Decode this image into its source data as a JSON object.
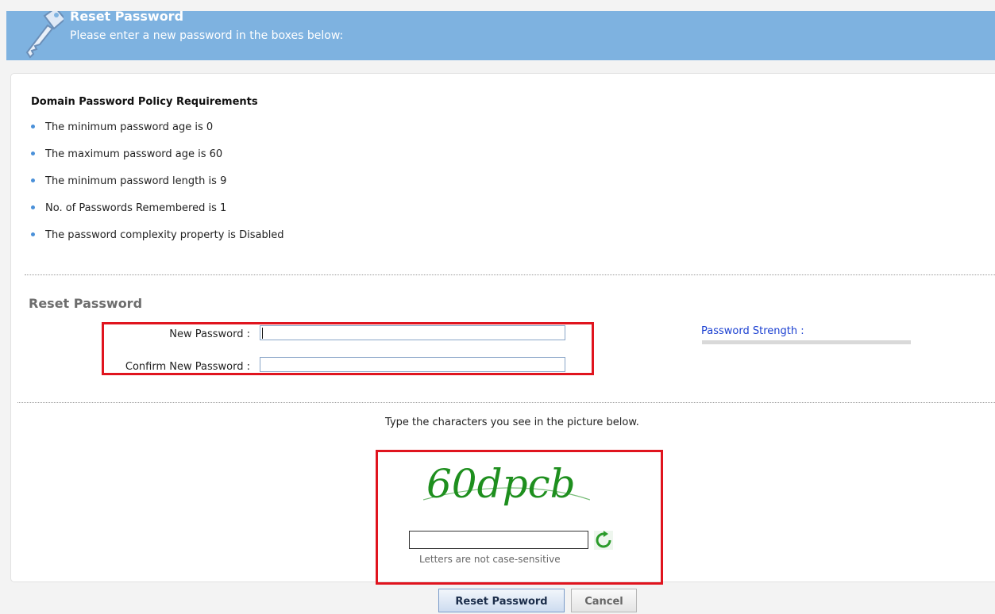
{
  "header": {
    "title": "Reset Password",
    "subtitle": "Please enter a new password in the boxes below:",
    "icon": "key-icon"
  },
  "policy": {
    "title": "Domain Password Policy Requirements",
    "items": [
      "The minimum password age is 0",
      "The maximum password age is 60",
      "The minimum password length is 9",
      "No. of Passwords Remembered is 1",
      "The password complexity property is Disabled"
    ]
  },
  "reset": {
    "section_title": "Reset Password",
    "new_password_label": "New Password :",
    "confirm_password_label": "Confirm New Password :",
    "new_password_value": "",
    "confirm_password_value": "",
    "strength_label": "Password Strength :"
  },
  "captcha": {
    "instruction": "Type the characters you see in the picture below.",
    "image_text": "60dpcb",
    "input_value": "",
    "note": "Letters are not case-sensitive",
    "refresh_icon": "refresh-icon"
  },
  "actions": {
    "reset_label": "Reset Password",
    "cancel_label": "Cancel"
  },
  "colors": {
    "header_bg": "#7eb2e0",
    "highlight_box": "#e0141e",
    "strength_text": "#1a3fd1",
    "captcha_text": "#1e8f1e"
  }
}
